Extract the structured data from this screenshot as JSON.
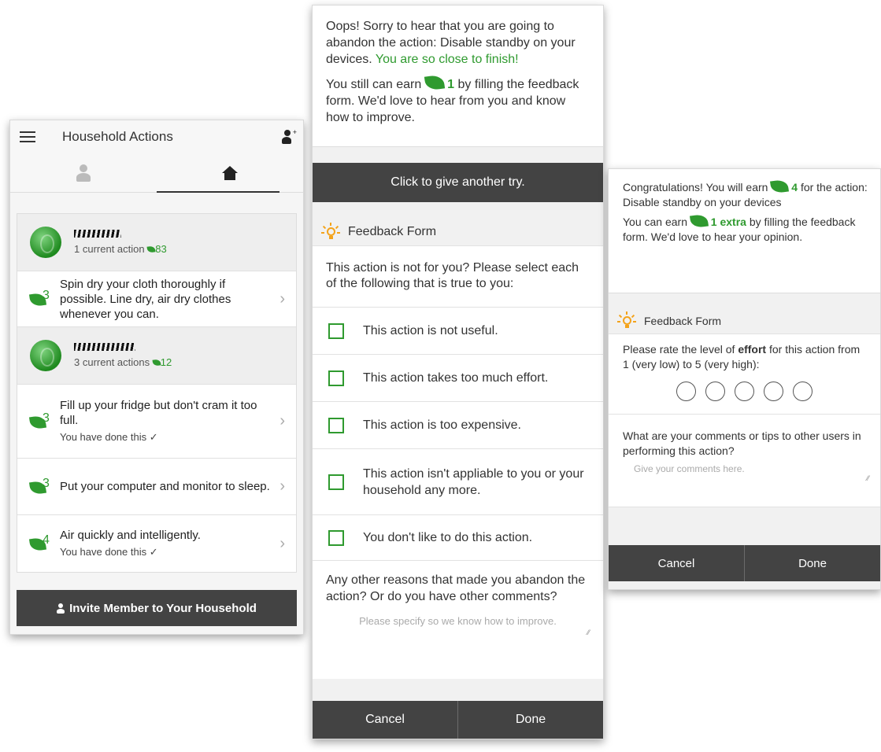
{
  "screen1": {
    "title": "Household Actions",
    "members": [
      {
        "subtitle": "1 current action",
        "points": "83"
      },
      {
        "subtitle": "3 current actions",
        "points": "12"
      }
    ],
    "actions": [
      {
        "points": "3",
        "text": "Spin dry your cloth thoroughly if possible. Line dry, air dry clothes whenever you can.",
        "done": ""
      },
      {
        "points": "3",
        "text": "Fill up your fridge but don't cram it too full.",
        "done": "You have done this ✓"
      },
      {
        "points": "3",
        "text": "Put your computer and monitor to sleep.",
        "done": ""
      },
      {
        "points": "4",
        "text": "Air quickly and intelligently.",
        "done": "You have done this ✓"
      }
    ],
    "invite_label": "Invite Member to Your Household"
  },
  "screen2": {
    "msg_line1": "Oops! Sorry to hear that you are going to abandon the action: Disable standby on your devices.",
    "msg_highlight": "You are so close to finish!",
    "earn_prefix": "You still can earn",
    "earn_points": "1",
    "earn_suffix": "by filling the feedback form. We'd love to hear from you and know how to improve.",
    "try_again": "Click to give another try.",
    "form_title": "Feedback Form",
    "question": "This action is not for you? Please select each of the following that is true to you:",
    "options": [
      "This action is not useful.",
      "This action takes too much effort.",
      "This action is too expensive.",
      "This action isn't appliable to you or your household any more.",
      "You don't like to do this action."
    ],
    "other_question": "Any other reasons that made you abandon the action? Or do you have other comments?",
    "other_placeholder": "Please specify so we know how to improve.",
    "cancel": "Cancel",
    "done": "Done"
  },
  "screen3": {
    "congrats_prefix": "Congratulations! You will earn",
    "congrats_points": "4",
    "congrats_suffix": "for the action: Disable standby on your devices",
    "earn_prefix": "You can earn",
    "earn_points": "1 extra",
    "earn_suffix": "by filling the feedback form. We'd love to hear your opinion.",
    "form_title": "Feedback Form",
    "rate_prefix": "Please rate the level of",
    "rate_bold": "effort",
    "rate_suffix": "for this action from 1 (very low) to 5 (very high):",
    "comments_question": "What are your comments or tips to other users in performing this action?",
    "comments_placeholder": "Give your comments here.",
    "cancel": "Cancel",
    "done": "Done"
  },
  "colors": {
    "accent_green": "#2f9a2f",
    "bar_dark": "#434343",
    "bulb_orange": "#f4a31b"
  }
}
